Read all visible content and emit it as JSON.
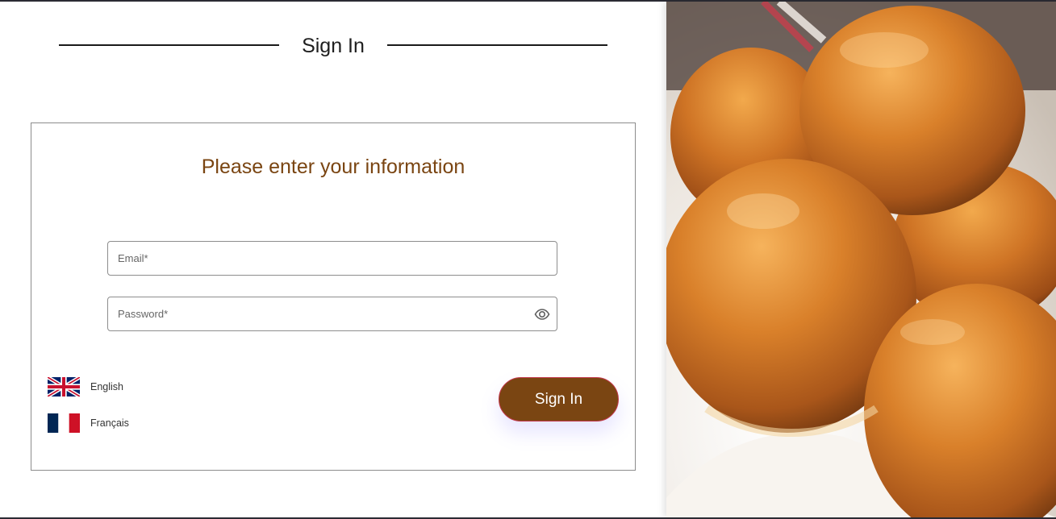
{
  "header": {
    "title": "Sign In"
  },
  "form": {
    "heading": "Please enter your information",
    "email": {
      "value": "",
      "placeholder": "Email*"
    },
    "password": {
      "value": "",
      "placeholder": "Password*",
      "toggle_icon": "eye-icon"
    },
    "submit_label": "Sign In"
  },
  "languages": [
    {
      "label": "English",
      "icon": "uk-flag-icon"
    },
    {
      "label": "Français",
      "icon": "france-flag-icon"
    }
  ],
  "hero_image": {
    "subject": "bread-rolls-photo"
  },
  "colors": {
    "accent": "#7a4512",
    "button_border": "#c2374a",
    "heading": "#7a4512",
    "text": "#1f1f1f",
    "border": "#8c8c8c"
  }
}
